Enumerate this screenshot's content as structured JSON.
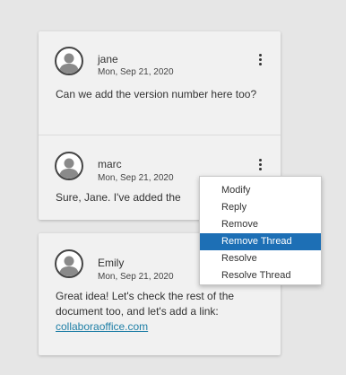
{
  "threads": [
    {
      "comments": [
        {
          "author": "jane",
          "date": "Mon, Sep 21, 2020",
          "text": "Can we add the version number here too?"
        },
        {
          "author": "marc",
          "date": "Mon, Sep 21, 2020",
          "text": "Sure, Jane. I've added the"
        }
      ]
    },
    {
      "comments": [
        {
          "author": "Emily",
          "date": "Mon, Sep 21, 2020",
          "text": "Great idea! Let's check the rest of the document too, and let's add a link:",
          "link": "collaboraoffice.com"
        }
      ]
    }
  ],
  "context_menu": {
    "items": [
      "Modify",
      "Reply",
      "Remove",
      "Remove Thread",
      "Resolve",
      "Resolve Thread"
    ],
    "highlighted_item": "Remove Thread"
  },
  "icons": {
    "avatar": "user-avatar-icon",
    "more": "more-options-icon"
  },
  "colors": {
    "background": "#e6e6e6",
    "card": "#f1f1f1",
    "menu_highlight": "#1d6fb5",
    "link": "#1f7fa6"
  }
}
